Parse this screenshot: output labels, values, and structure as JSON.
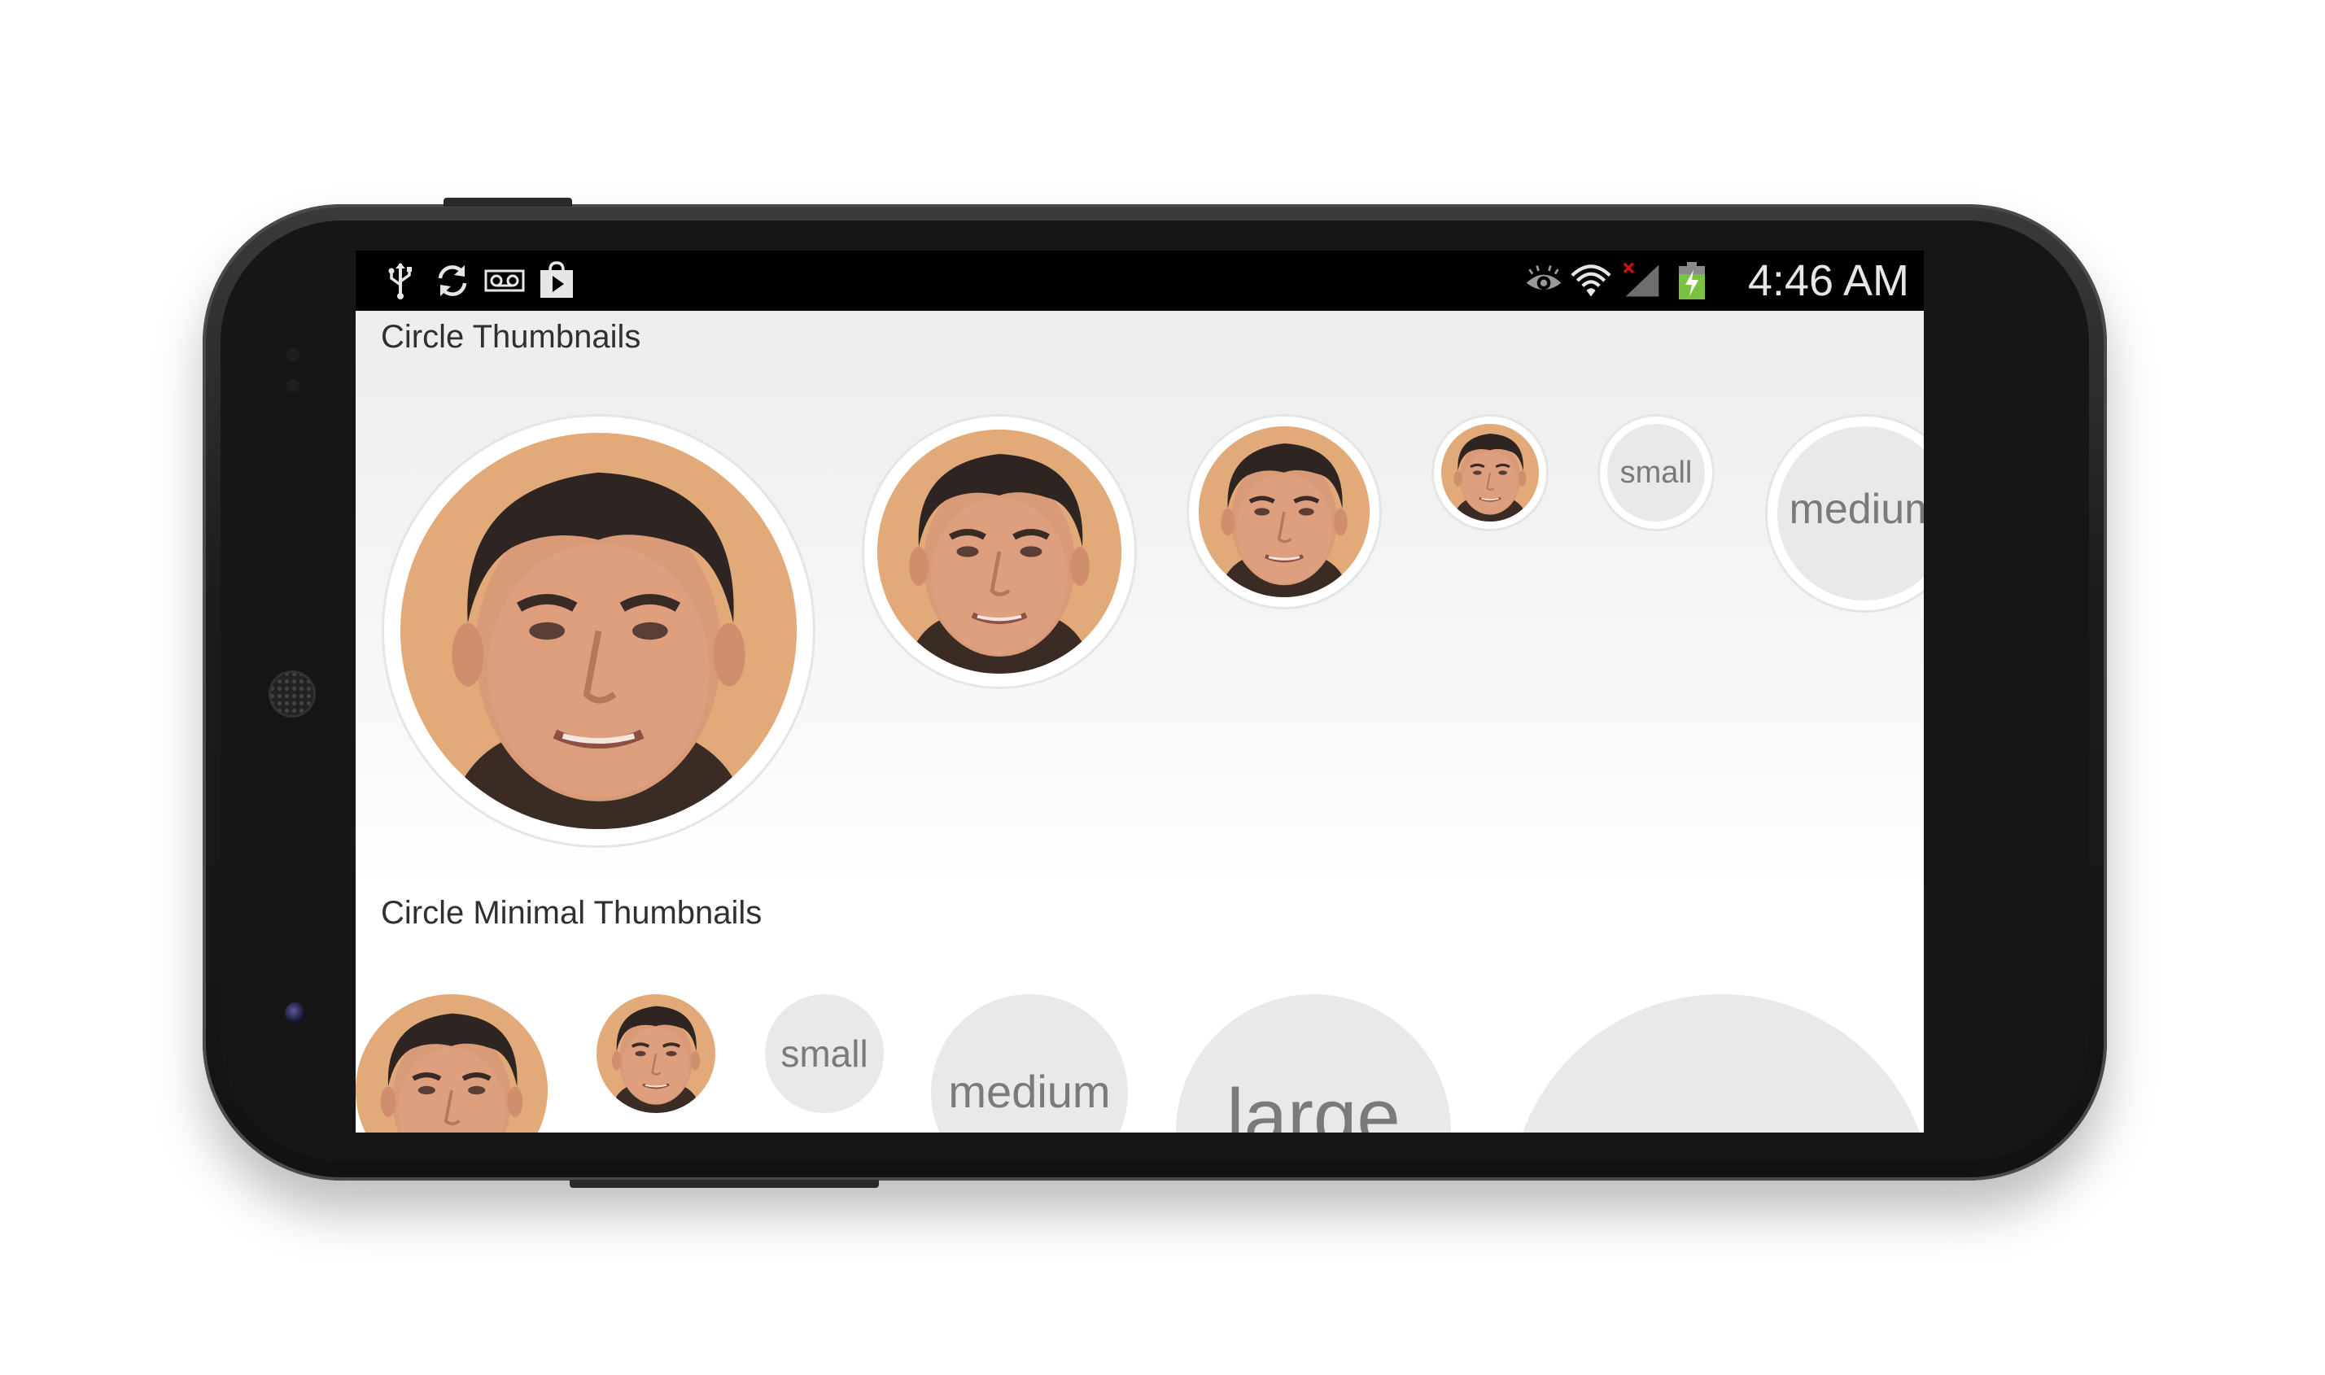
{
  "statusbar": {
    "time": "4:46 AM",
    "left_icons": [
      "usb-icon",
      "sync-icon",
      "voicemail-icon",
      "play-store-icon"
    ],
    "right_icons": [
      "eye-icon",
      "wifi-icon",
      "no-signal-icon",
      "battery-charging-icon"
    ],
    "colors": {
      "battery": "#7cc242",
      "no_signal_x": "#cc1111"
    }
  },
  "sections": {
    "circle_thumbnails": {
      "title": "Circle Thumbnails",
      "items": [
        {
          "kind": "photo",
          "size": "xlarge"
        },
        {
          "kind": "photo",
          "size": "large"
        },
        {
          "kind": "photo",
          "size": "medium"
        },
        {
          "kind": "photo",
          "size": "small"
        },
        {
          "kind": "text",
          "label": "small"
        },
        {
          "kind": "text",
          "label": "medium"
        }
      ]
    },
    "circle_minimal_thumbnails": {
      "title": "Circle Minimal Thumbnails",
      "items": [
        {
          "kind": "photo",
          "size": "medium"
        },
        {
          "kind": "photo",
          "size": "small"
        },
        {
          "kind": "text",
          "label": "small"
        },
        {
          "kind": "text",
          "label": "medium"
        },
        {
          "kind": "text",
          "label": "large"
        },
        {
          "kind": "text",
          "label": ""
        }
      ]
    }
  },
  "colors": {
    "skin": "#d9a27e",
    "hair": "#2e2422",
    "background_warm": "#e6b07a",
    "placeholder": "#e9e9e9",
    "placeholder_text": "#7a7a7a"
  }
}
